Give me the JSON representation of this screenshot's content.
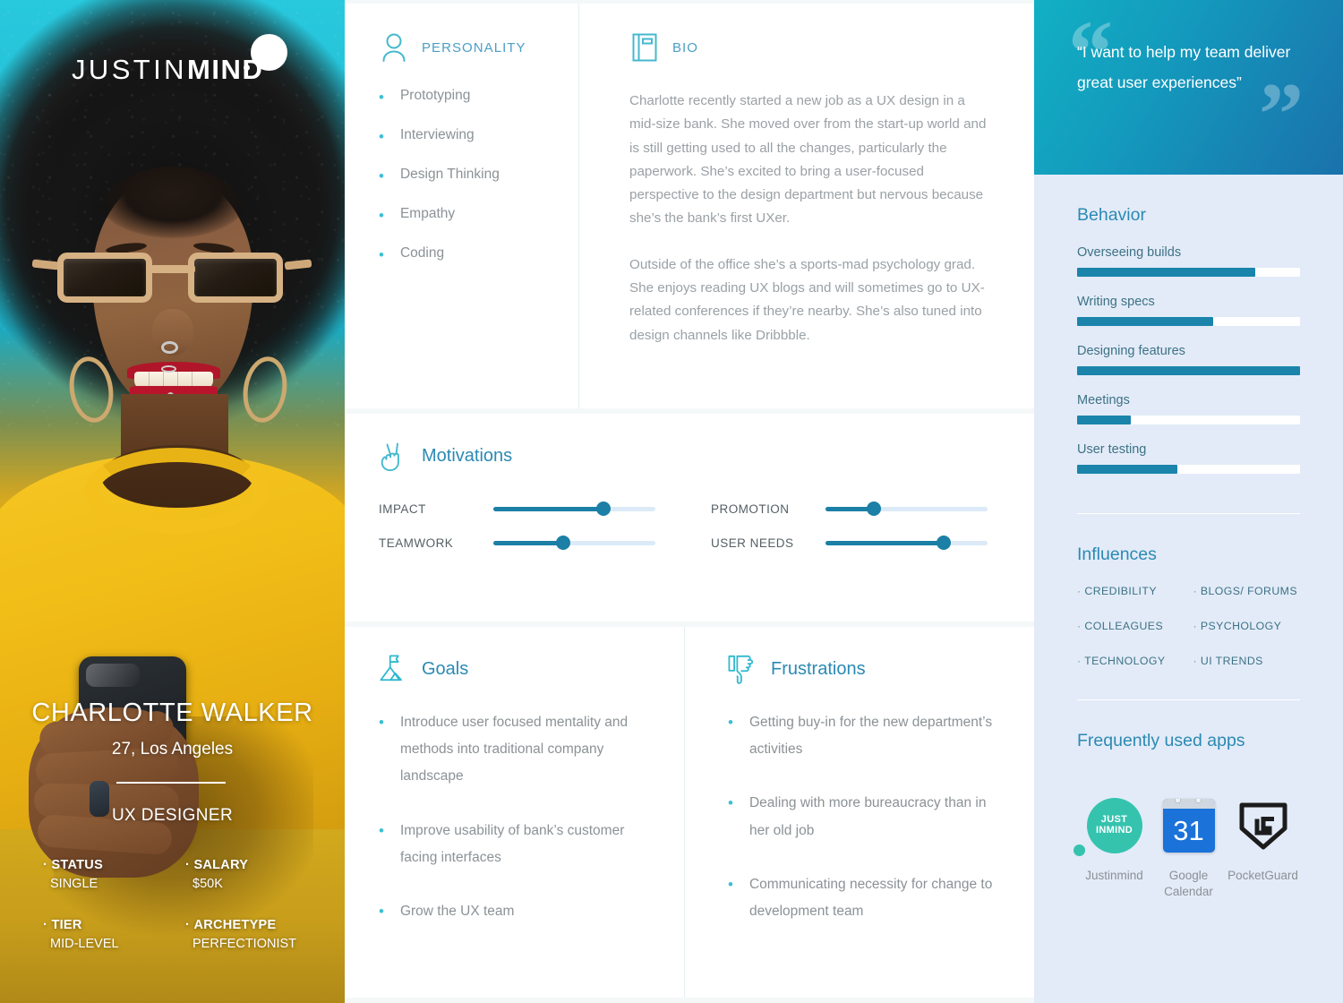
{
  "brand": {
    "logo_light": "JUSTIN",
    "logo_bold": "MIND"
  },
  "persona": {
    "name": "CHARLOTTE WALKER",
    "age_location": "27, Los Angeles",
    "role": "UX DESIGNER",
    "attributes": [
      {
        "key": "STATUS",
        "value": "SINGLE"
      },
      {
        "key": "SALARY",
        "value": "$50K"
      },
      {
        "key": "TIER",
        "value": "MID-LEVEL"
      },
      {
        "key": "ARCHETYPE",
        "value": "PERFECTIONIST"
      }
    ]
  },
  "personality": {
    "title": "PERSONALITY",
    "icon": "person-icon",
    "traits": [
      "Prototyping",
      "Interviewing",
      "Design Thinking",
      "Empathy",
      "Coding"
    ]
  },
  "bio": {
    "title": "BIO",
    "icon": "book-icon",
    "paragraphs": [
      "Charlotte recently started a new job as a UX design in a mid-size bank. She moved over from the start-up world and is still getting used to all the changes, particularly the paperwork. She’s excited to bring a user-focused perspective to the design department but nervous because she’s the bank’s first UXer.",
      "Outside of the office she’s a sports-mad psychology grad. She enjoys reading UX blogs and will sometimes go to UX-related conferences if they’re nearby. She’s also tuned into design channels like Dribbble."
    ]
  },
  "motivations": {
    "title": "Motivations",
    "icon": "peace-hand-icon",
    "items": [
      {
        "label": "IMPACT",
        "value": 68
      },
      {
        "label": "PROMOTION",
        "value": 30
      },
      {
        "label": "TEAMWORK",
        "value": 43
      },
      {
        "label": "USER NEEDS",
        "value": 73
      }
    ]
  },
  "goals": {
    "title": "Goals",
    "icon": "mountain-flag-icon",
    "items": [
      "Introduce user focused mentality and methods into traditional company landscape",
      "Improve usability of bank’s customer facing interfaces",
      "Grow the UX team"
    ]
  },
  "frustrations": {
    "title": "Frustrations",
    "icon": "thumbs-down-icon",
    "items": [
      "Getting buy-in for the new department’s activities",
      "Dealing with more bureaucracy than in her old job",
      "Communicating necessity for change to development team"
    ]
  },
  "quote": {
    "text": "“I want to help my team deliver great user experiences”"
  },
  "behavior": {
    "title": "Behavior",
    "items": [
      {
        "label": "Overseeing builds",
        "value": 80
      },
      {
        "label": "Writing specs",
        "value": 61
      },
      {
        "label": "Designing features",
        "value": 100
      },
      {
        "label": "Meetings",
        "value": 24
      },
      {
        "label": "User testing",
        "value": 45
      }
    ]
  },
  "influences": {
    "title": "Influences",
    "items": [
      "CREDIBILITY",
      "BLOGS/ FORUMS",
      "COLLEAGUES",
      "PSYCHOLOGY",
      "TECHNOLOGY",
      "UI TRENDS"
    ]
  },
  "apps": {
    "title": "Frequently used apps",
    "items": [
      {
        "name": "Justinmind",
        "icon": "justinmind-icon",
        "logo_top": "JUST",
        "logo_bottom": "INMIND",
        "color": "#35c3ae"
      },
      {
        "name": "Google Calendar",
        "icon": "google-calendar-icon",
        "day": "31",
        "color": "#1b72d9"
      },
      {
        "name": "PocketGuard",
        "icon": "pocketguard-icon",
        "color": "#1c1c1c"
      }
    ]
  },
  "colors": {
    "accent": "#2b8ab3",
    "teal": "#3dbfd4",
    "bar": "#1a84ab",
    "sidebar_bg": "#e3ebf8"
  }
}
